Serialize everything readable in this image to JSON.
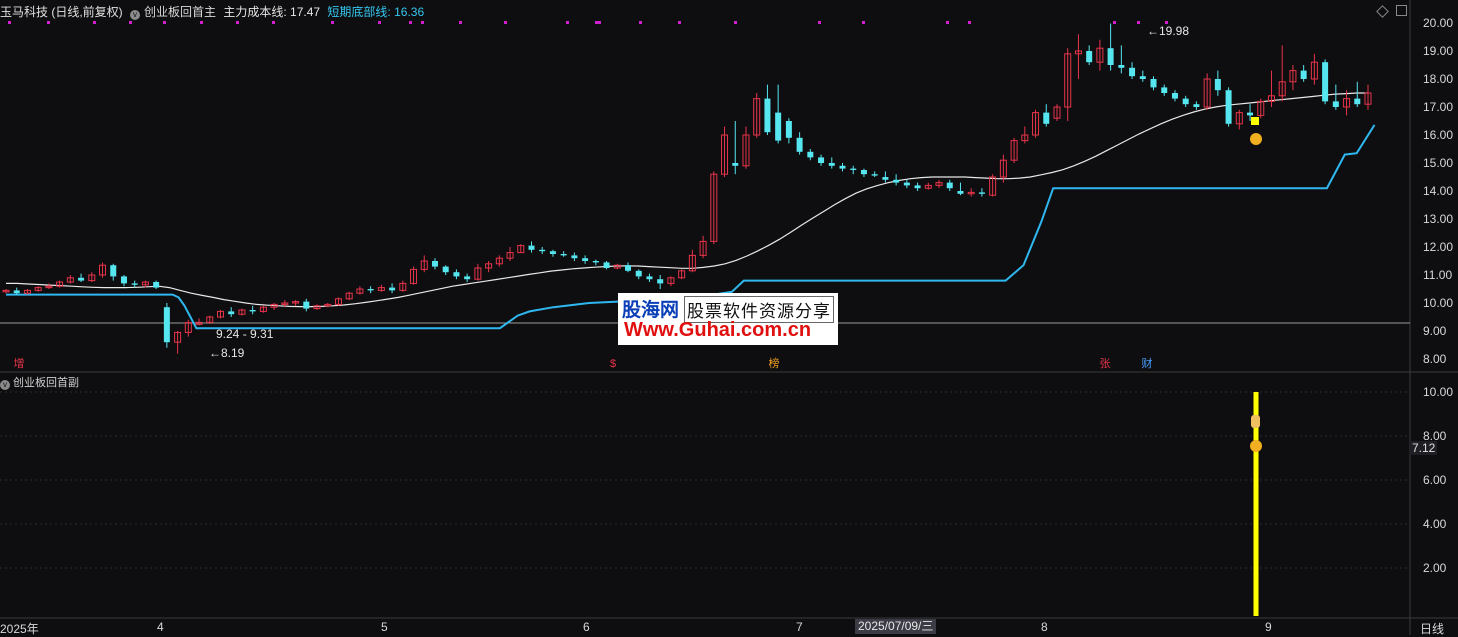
{
  "header": {
    "stock": "玉马科技 (日线,前复权)",
    "indicator": "创业板回首主",
    "cost_label": "主力成本线: 17.47",
    "short_label": "短期底部线: 16.36"
  },
  "sub_indicator": "创业板回首副",
  "colors": {
    "up": "#e8344a",
    "down": "#55e6f0",
    "ma": "#e8e8e8",
    "floor": "#2fb8f0",
    "signal": "#ffff00"
  },
  "price_axis": {
    "ticks": [
      "20.00",
      "19.00",
      "18.00",
      "17.00",
      "16.00",
      "15.00",
      "14.00",
      "13.00",
      "12.00",
      "11.00",
      "10.00",
      "9.00",
      "8.00"
    ]
  },
  "sub_axis": {
    "ticks": [
      "10.00",
      "8.00",
      "6.00",
      "4.00",
      "2.00"
    ],
    "current": "7.12"
  },
  "time_axis": {
    "labels": [
      "2025年",
      "4",
      "5",
      "6",
      "7",
      "8",
      "9"
    ],
    "period": "日线",
    "cursor_date": "2025/07/09/三"
  },
  "annotations": {
    "range": "9.24 - 9.31",
    "low": "←8.19",
    "high": "←19.98"
  },
  "events": [
    {
      "label": "增",
      "color": "#e8344a"
    },
    {
      "label": "$",
      "color": "#e8344a"
    },
    {
      "label": "榜",
      "color": "#f0a020"
    },
    {
      "label": "张",
      "color": "#e8344a"
    },
    {
      "label": "财",
      "color": "#4aa0ff"
    }
  ],
  "watermark": {
    "line1": "股海网",
    "line2": "股票软件资源分享",
    "url": "Www.Guhai.com.cn"
  },
  "chart_data": {
    "type": "candlestick",
    "ylim": [
      7.8,
      20.3
    ],
    "ohlc": [
      [
        10.4,
        10.5,
        10.35,
        10.45
      ],
      [
        10.45,
        10.55,
        10.3,
        10.35
      ],
      [
        10.35,
        10.5,
        10.3,
        10.45
      ],
      [
        10.45,
        10.6,
        10.4,
        10.55
      ],
      [
        10.55,
        10.7,
        10.5,
        10.6
      ],
      [
        10.6,
        10.8,
        10.55,
        10.75
      ],
      [
        10.75,
        11.0,
        10.7,
        10.9
      ],
      [
        10.9,
        11.05,
        10.75,
        10.8
      ],
      [
        10.8,
        11.1,
        10.75,
        11.0
      ],
      [
        11.0,
        11.45,
        10.9,
        11.35
      ],
      [
        11.35,
        11.4,
        10.8,
        10.95
      ],
      [
        10.95,
        11.0,
        10.6,
        10.7
      ],
      [
        10.7,
        10.8,
        10.55,
        10.65
      ],
      [
        10.65,
        10.8,
        10.55,
        10.75
      ],
      [
        10.75,
        10.8,
        10.5,
        10.55
      ],
      [
        9.85,
        10.0,
        8.4,
        8.6
      ],
      [
        8.6,
        9.0,
        8.19,
        8.95
      ],
      [
        8.95,
        9.4,
        8.8,
        9.3
      ],
      [
        9.24,
        9.45,
        9.2,
        9.31
      ],
      [
        9.31,
        9.55,
        9.25,
        9.5
      ],
      [
        9.5,
        9.75,
        9.45,
        9.7
      ],
      [
        9.7,
        9.85,
        9.5,
        9.6
      ],
      [
        9.6,
        9.8,
        9.55,
        9.75
      ],
      [
        9.75,
        9.9,
        9.6,
        9.7
      ],
      [
        9.7,
        9.9,
        9.65,
        9.85
      ],
      [
        9.85,
        10.0,
        9.75,
        9.95
      ],
      [
        9.95,
        10.1,
        9.85,
        10.0
      ],
      [
        10.0,
        10.1,
        9.9,
        10.05
      ],
      [
        10.05,
        10.15,
        9.7,
        9.8
      ],
      [
        9.8,
        9.95,
        9.75,
        9.9
      ],
      [
        9.9,
        10.0,
        9.85,
        9.95
      ],
      [
        9.95,
        10.2,
        9.9,
        10.15
      ],
      [
        10.15,
        10.4,
        10.1,
        10.35
      ],
      [
        10.35,
        10.6,
        10.3,
        10.5
      ],
      [
        10.5,
        10.6,
        10.35,
        10.45
      ],
      [
        10.45,
        10.65,
        10.4,
        10.55
      ],
      [
        10.55,
        10.7,
        10.35,
        10.45
      ],
      [
        10.45,
        10.8,
        10.4,
        10.7
      ],
      [
        10.7,
        11.3,
        10.65,
        11.2
      ],
      [
        11.2,
        11.7,
        11.1,
        11.5
      ],
      [
        11.5,
        11.6,
        11.2,
        11.3
      ],
      [
        11.3,
        11.35,
        11.0,
        11.1
      ],
      [
        11.1,
        11.2,
        10.85,
        10.95
      ],
      [
        10.95,
        11.05,
        10.75,
        10.85
      ],
      [
        10.85,
        11.4,
        10.8,
        11.25
      ],
      [
        11.25,
        11.5,
        11.1,
        11.4
      ],
      [
        11.4,
        11.7,
        11.3,
        11.6
      ],
      [
        11.6,
        12.0,
        11.5,
        11.8
      ],
      [
        11.8,
        12.1,
        11.8,
        12.05
      ],
      [
        12.05,
        12.2,
        11.8,
        11.9
      ],
      [
        11.9,
        12.0,
        11.75,
        11.85
      ],
      [
        11.85,
        11.9,
        11.65,
        11.75
      ],
      [
        11.75,
        11.85,
        11.65,
        11.7
      ],
      [
        11.7,
        11.8,
        11.5,
        11.6
      ],
      [
        11.6,
        11.7,
        11.4,
        11.5
      ],
      [
        11.5,
        11.55,
        11.35,
        11.45
      ],
      [
        11.45,
        11.5,
        11.2,
        11.25
      ],
      [
        11.25,
        11.4,
        11.2,
        11.35
      ],
      [
        11.35,
        11.45,
        11.1,
        11.15
      ],
      [
        11.15,
        11.2,
        10.85,
        10.95
      ],
      [
        10.95,
        11.05,
        10.75,
        10.85
      ],
      [
        10.85,
        11.0,
        10.5,
        10.7
      ],
      [
        10.7,
        10.95,
        10.6,
        10.9
      ],
      [
        10.9,
        11.2,
        10.85,
        11.15
      ],
      [
        11.15,
        11.9,
        11.1,
        11.7
      ],
      [
        11.7,
        12.4,
        11.6,
        12.2
      ],
      [
        12.2,
        14.7,
        12.1,
        14.6
      ],
      [
        14.6,
        16.3,
        14.5,
        16.0
      ],
      [
        15.0,
        16.5,
        14.6,
        14.9
      ],
      [
        14.9,
        16.3,
        14.8,
        16.0
      ],
      [
        16.0,
        17.5,
        15.9,
        17.3
      ],
      [
        17.3,
        17.8,
        16.0,
        16.1
      ],
      [
        16.8,
        17.8,
        15.7,
        15.8
      ],
      [
        16.5,
        16.6,
        15.7,
        15.9
      ],
      [
        15.9,
        16.1,
        15.3,
        15.4
      ],
      [
        15.4,
        15.5,
        15.1,
        15.2
      ],
      [
        15.2,
        15.3,
        14.9,
        15.0
      ],
      [
        15.0,
        15.2,
        14.8,
        14.9
      ],
      [
        14.9,
        15.0,
        14.7,
        14.8
      ],
      [
        14.8,
        14.9,
        14.6,
        14.75
      ],
      [
        14.75,
        14.8,
        14.5,
        14.6
      ],
      [
        14.6,
        14.7,
        14.5,
        14.55
      ],
      [
        14.5,
        14.7,
        14.3,
        14.4
      ],
      [
        14.4,
        14.6,
        14.2,
        14.3
      ],
      [
        14.3,
        14.4,
        14.1,
        14.2
      ],
      [
        14.2,
        14.3,
        14.0,
        14.1
      ],
      [
        14.1,
        14.3,
        14.05,
        14.2
      ],
      [
        14.2,
        14.4,
        14.1,
        14.3
      ],
      [
        14.3,
        14.4,
        14.0,
        14.1
      ],
      [
        14.0,
        14.3,
        13.85,
        13.9
      ],
      [
        13.9,
        14.1,
        13.8,
        13.95
      ],
      [
        13.95,
        14.1,
        13.8,
        13.9
      ],
      [
        13.85,
        14.6,
        13.8,
        14.5
      ],
      [
        14.5,
        15.3,
        14.3,
        15.1
      ],
      [
        15.1,
        15.9,
        15.0,
        15.8
      ],
      [
        15.8,
        16.3,
        15.7,
        16.0
      ],
      [
        16.0,
        16.9,
        15.9,
        16.8
      ],
      [
        16.8,
        17.1,
        16.3,
        16.4
      ],
      [
        16.6,
        17.1,
        16.5,
        17.0
      ],
      [
        17.0,
        19.1,
        16.5,
        18.9
      ],
      [
        18.9,
        19.6,
        18.0,
        19.0
      ],
      [
        19.0,
        19.2,
        18.5,
        18.6
      ],
      [
        18.6,
        19.4,
        18.3,
        19.1
      ],
      [
        19.1,
        19.98,
        18.3,
        18.5
      ],
      [
        18.5,
        19.2,
        18.2,
        18.4
      ],
      [
        18.4,
        18.6,
        18.0,
        18.1
      ],
      [
        18.1,
        18.3,
        17.9,
        18.0
      ],
      [
        18.0,
        18.1,
        17.6,
        17.7
      ],
      [
        17.7,
        17.8,
        17.4,
        17.5
      ],
      [
        17.5,
        17.6,
        17.2,
        17.3
      ],
      [
        17.3,
        17.4,
        17.0,
        17.1
      ],
      [
        17.1,
        17.2,
        16.9,
        17.0
      ],
      [
        17.0,
        18.2,
        16.9,
        18.0
      ],
      [
        18.0,
        18.3,
        17.4,
        17.6
      ],
      [
        17.6,
        17.7,
        16.3,
        16.4
      ],
      [
        16.4,
        16.9,
        16.2,
        16.8
      ],
      [
        16.8,
        17.1,
        16.5,
        16.7
      ],
      [
        16.7,
        17.3,
        16.6,
        17.2
      ],
      [
        17.2,
        18.3,
        17.0,
        17.4
      ],
      [
        17.4,
        19.2,
        17.2,
        17.9
      ],
      [
        17.9,
        18.5,
        17.6,
        18.3
      ],
      [
        18.3,
        18.5,
        17.9,
        18.0
      ],
      [
        18.0,
        18.9,
        17.8,
        18.6
      ],
      [
        18.6,
        18.7,
        17.1,
        17.2
      ],
      [
        17.2,
        17.8,
        16.9,
        17.0
      ],
      [
        17.0,
        17.6,
        16.7,
        17.3
      ],
      [
        17.3,
        17.9,
        17.0,
        17.1
      ],
      [
        17.1,
        17.8,
        16.9,
        17.5
      ]
    ],
    "ma": [
      10.7,
      10.7,
      10.68,
      10.66,
      10.64,
      10.62,
      10.6,
      10.58,
      10.56,
      10.55,
      10.55,
      10.55,
      10.56,
      10.58,
      10.6,
      10.55,
      10.45,
      10.35,
      10.27,
      10.2,
      10.12,
      10.06,
      10.0,
      9.95,
      9.92,
      9.9,
      9.88,
      9.87,
      9.87,
      9.88,
      9.9,
      9.93,
      9.97,
      10.02,
      10.08,
      10.14,
      10.2,
      10.28,
      10.36,
      10.44,
      10.52,
      10.6,
      10.66,
      10.72,
      10.78,
      10.84,
      10.9,
      10.96,
      11.02,
      11.08,
      11.14,
      11.18,
      11.22,
      11.25,
      11.28,
      11.3,
      11.32,
      11.33,
      11.32,
      11.3,
      11.28,
      11.26,
      11.24,
      11.24,
      11.27,
      11.32,
      11.4,
      11.52,
      11.68,
      11.86,
      12.06,
      12.28,
      12.52,
      12.78,
      13.02,
      13.26,
      13.5,
      13.72,
      13.92,
      14.08,
      14.2,
      14.3,
      14.38,
      14.44,
      14.48,
      14.5,
      14.5,
      14.5,
      14.5,
      14.48,
      14.46,
      14.44,
      14.44,
      14.46,
      14.5,
      14.58,
      14.66,
      14.76,
      14.9,
      15.06,
      15.24,
      15.44,
      15.64,
      15.84,
      16.04,
      16.22,
      16.4,
      16.56,
      16.7,
      16.82,
      16.92,
      17.0,
      17.06,
      17.1,
      17.14,
      17.18,
      17.22,
      17.26,
      17.3,
      17.34,
      17.38,
      17.42,
      17.46,
      17.48,
      17.5,
      17.5
    ],
    "floor": [
      [
        0,
        10.3
      ],
      [
        28,
        10.3
      ],
      [
        29,
        10.2
      ],
      [
        30,
        9.9
      ],
      [
        32,
        9.1
      ],
      [
        83,
        9.1
      ],
      [
        86,
        9.55
      ],
      [
        88,
        9.7
      ],
      [
        92,
        9.85
      ],
      [
        98,
        10.0
      ],
      [
        108,
        10.1
      ],
      [
        116,
        10.2
      ],
      [
        122,
        10.4
      ],
      [
        124,
        10.8
      ],
      [
        168,
        10.8
      ],
      [
        171,
        11.35
      ],
      [
        174,
        12.9
      ],
      [
        176,
        14.1
      ],
      [
        222,
        14.1
      ],
      [
        223,
        14.5
      ],
      [
        225,
        15.3
      ],
      [
        227,
        15.35
      ],
      [
        230,
        16.36
      ]
    ],
    "signal_bar": {
      "value": 10.0
    }
  }
}
